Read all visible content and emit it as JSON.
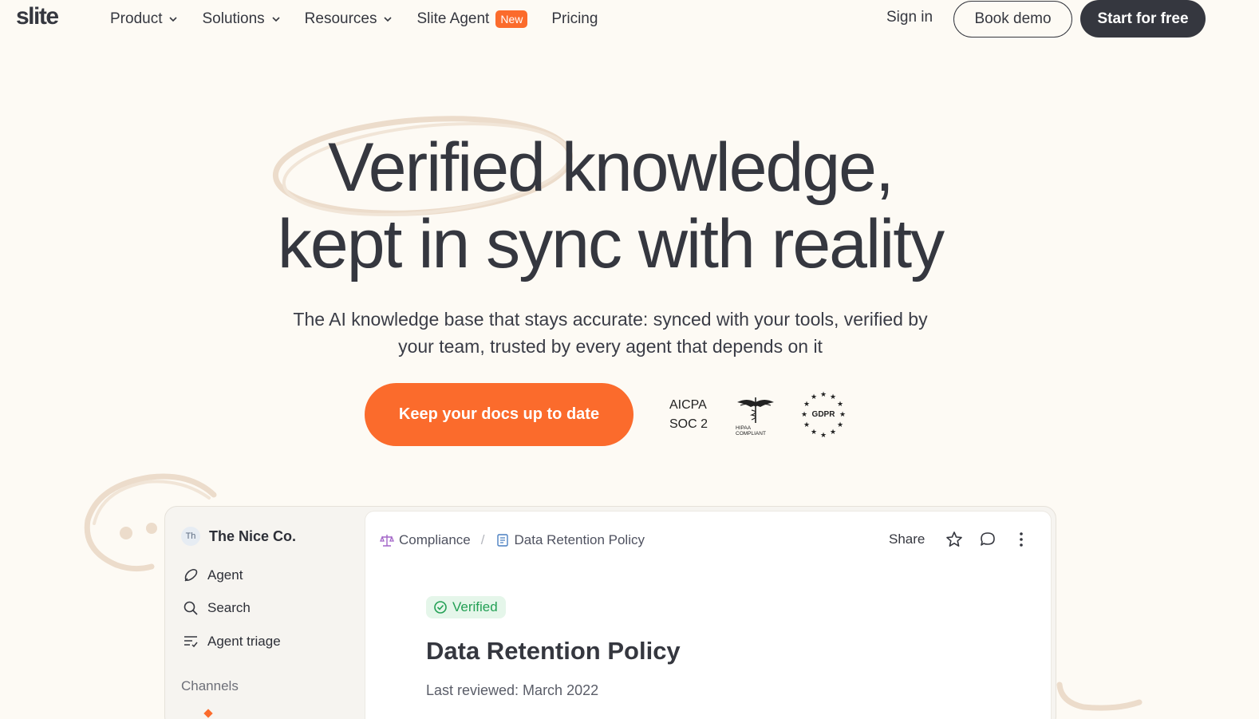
{
  "nav": {
    "logo": "slite",
    "items": [
      {
        "label": "Product"
      },
      {
        "label": "Solutions"
      },
      {
        "label": "Resources"
      },
      {
        "label": "Slite Agent",
        "badge": "New"
      },
      {
        "label": "Pricing"
      }
    ],
    "sign_in": "Sign in",
    "book_demo": "Book demo",
    "start_free": "Start for free"
  },
  "hero": {
    "title_line1": "Verified knowledge,",
    "title_line2": "kept in sync with reality",
    "subtitle_line1": "The AI knowledge base that stays accurate: synced with your tools, verified by",
    "subtitle_line2": "your team, trusted by every agent that depends on it",
    "cta": "Keep your docs up to date",
    "badges": {
      "aicpa_line1": "AICPA",
      "aicpa_line2": "SOC 2",
      "hipaa_line1": "HIPAA",
      "hipaa_line2": "COMPLIANT",
      "gdpr": "GDPR"
    }
  },
  "app": {
    "workspace_initials": "Th",
    "workspace_name": "The Nice Co.",
    "sidebar": [
      {
        "label": "Agent",
        "icon": "agent-icon"
      },
      {
        "label": "Search",
        "icon": "search-icon"
      },
      {
        "label": "Agent triage",
        "icon": "triage-icon"
      }
    ],
    "channels_label": "Channels",
    "breadcrumb": [
      {
        "label": "Compliance",
        "icon": "scale-icon"
      },
      {
        "label": "Data Retention Policy",
        "icon": "document-icon"
      }
    ],
    "share": "Share",
    "verified": "Verified",
    "doc_title": "Data Retention Policy",
    "last_reviewed": "Last reviewed: March 2022"
  },
  "colors": {
    "background": "#fdfaf4",
    "accent_orange": "#fb6b2c",
    "dark": "#35373f",
    "verified_green": "#23a055"
  }
}
